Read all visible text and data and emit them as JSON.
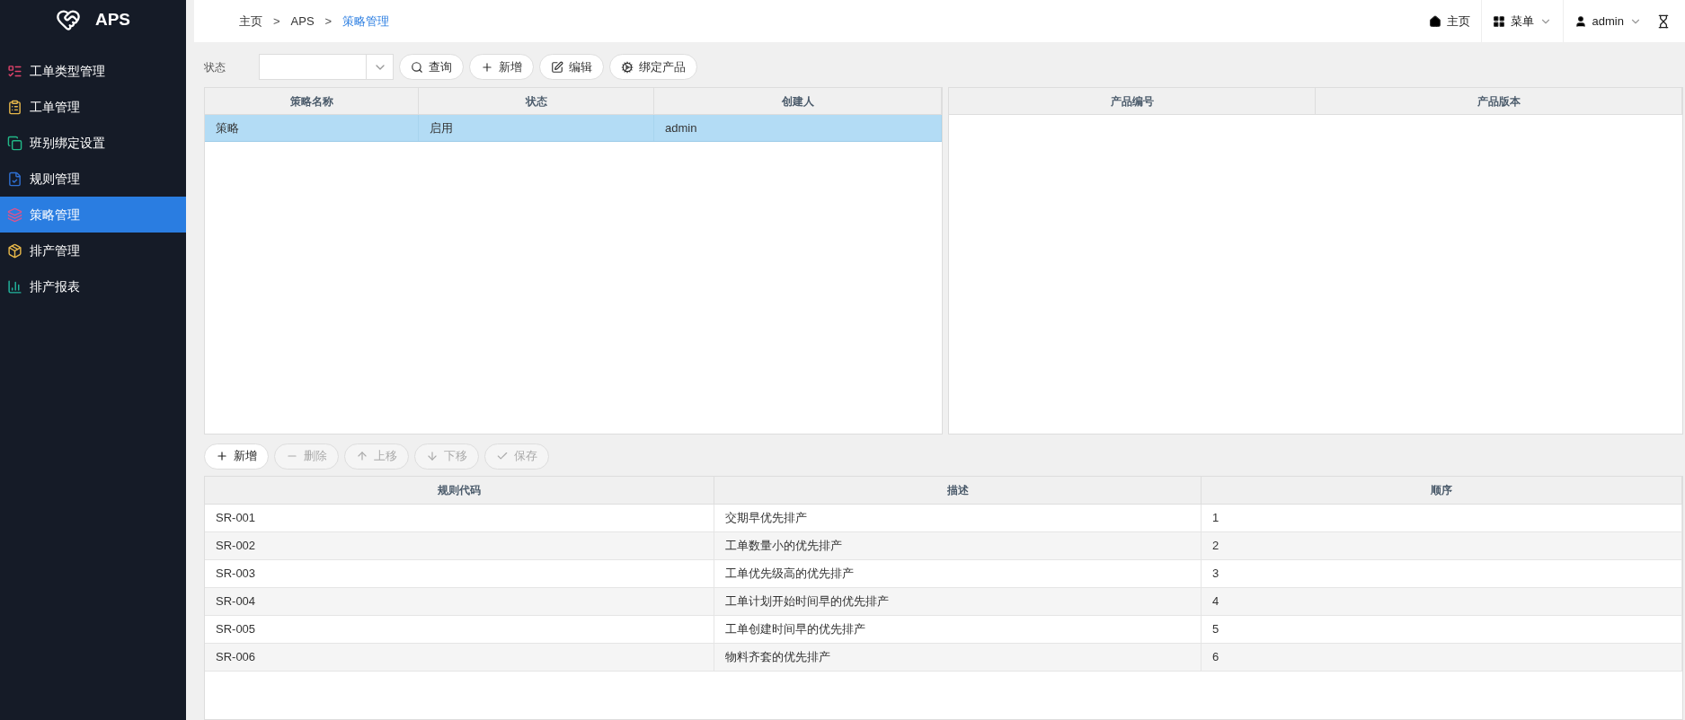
{
  "brand": {
    "name": "APS"
  },
  "sidebar": {
    "items": [
      {
        "label": "工单类型管理",
        "selected": false
      },
      {
        "label": "工单管理",
        "selected": false
      },
      {
        "label": "班别绑定设置",
        "selected": false
      },
      {
        "label": "规则管理",
        "selected": false
      },
      {
        "label": "策略管理",
        "selected": true
      },
      {
        "label": "排产管理",
        "selected": false
      },
      {
        "label": "排产报表",
        "selected": false
      }
    ]
  },
  "breadcrumb": [
    {
      "label": "主页",
      "current": false
    },
    {
      "separator": ">",
      "label": "APS",
      "current": false
    },
    {
      "separator": ">",
      "label": "策略管理",
      "current": true
    }
  ],
  "header_right": {
    "home": "主页",
    "menu": "菜单",
    "user": "admin"
  },
  "filter": {
    "label": "状态"
  },
  "toolbar": [
    {
      "label": "查询"
    },
    {
      "label": "新增"
    },
    {
      "label": "编辑"
    },
    {
      "label": "绑定产品"
    }
  ],
  "strategy_table": {
    "columns": [
      "策略名称",
      "状态",
      "创建人"
    ],
    "rows": [
      {
        "cells": [
          "策略",
          "启用",
          "admin"
        ],
        "selected": true
      }
    ]
  },
  "product_table": {
    "columns": [
      "产品编号",
      "产品版本"
    ]
  },
  "rule_toolbar": [
    {
      "label": "新增",
      "disabled": false
    },
    {
      "label": "删除",
      "disabled": true
    },
    {
      "label": "上移",
      "disabled": true
    },
    {
      "label": "下移",
      "disabled": true
    },
    {
      "label": "保存",
      "disabled": true
    }
  ],
  "rule_table": {
    "columns": [
      "规则代码",
      "描述",
      "顺序"
    ],
    "rows": [
      [
        "SR-001",
        "交期早优先排产",
        "1"
      ],
      [
        "SR-002",
        "工单数量小的优先排产",
        "2"
      ],
      [
        "SR-003",
        "工单优先级高的优先排产",
        "3"
      ],
      [
        "SR-004",
        "工单计划开始时间早的优先排产",
        "4"
      ],
      [
        "SR-005",
        "工单创建时间早的优先排产",
        "5"
      ],
      [
        "SR-006",
        "物料齐套的优先排产",
        "6"
      ]
    ]
  }
}
